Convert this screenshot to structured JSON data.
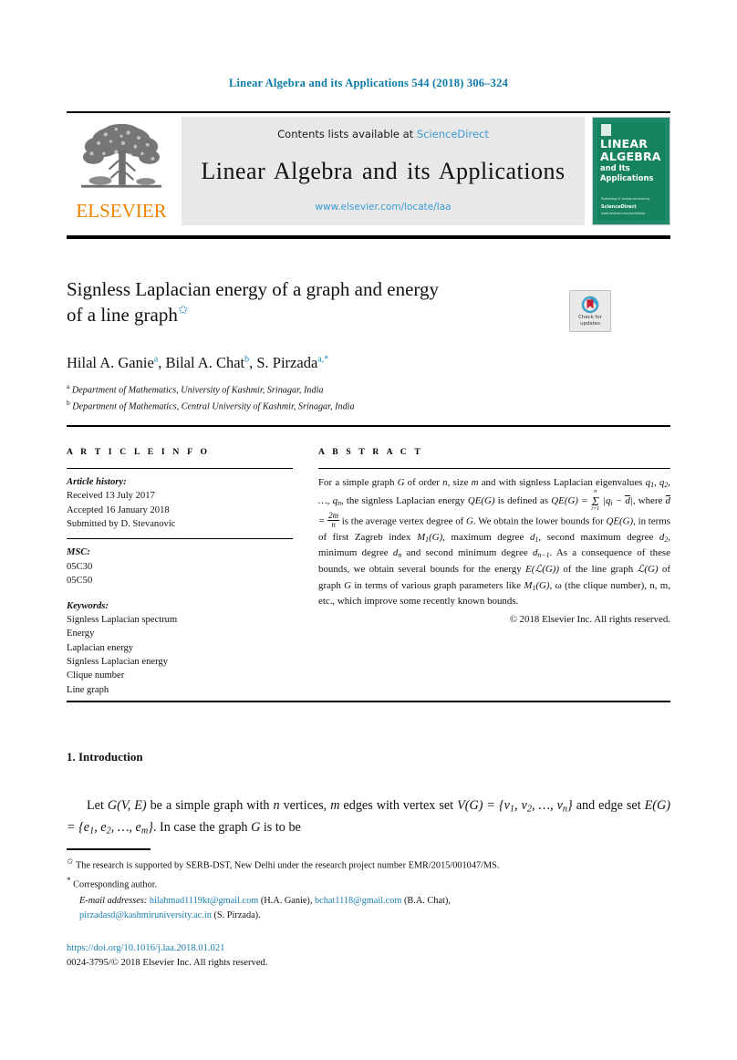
{
  "running_head": "Linear Algebra and its Applications 544 (2018) 306–324",
  "masthead": {
    "publisher_wordmark": "ELSEVIER",
    "contents_prefix": "Contents lists available at ",
    "contents_link": "ScienceDirect",
    "journal_name": "Linear Algebra and its Applications",
    "journal_url": "www.elsevier.com/locate/laa",
    "cover": {
      "line1": "LINEAR",
      "line2": "ALGEBRA",
      "line3": "and Its",
      "line4": "Applications",
      "foot_top": "Publishing & review services by",
      "foot_brand": "ScienceDirect",
      "foot_bottom": "www.elsevier.com/locate/laa",
      "bg_color": "#17825f"
    }
  },
  "title": {
    "line1": "Signless Laplacian energy of a graph and energy",
    "line2": "of a line graph",
    "footnote_mark": "✩"
  },
  "crossmark": {
    "line1": "Check for",
    "line2": "updates"
  },
  "authors": {
    "text": "Hilal A. Ganie",
    "list": [
      {
        "name": "Hilal A. Ganie",
        "mark": "a"
      },
      {
        "name": "Bilal A. Chat",
        "mark": "b"
      },
      {
        "name": "S. Pirzada",
        "mark": "a,*"
      }
    ],
    "affiliations": [
      {
        "mark": "a",
        "text": "Department of Mathematics, University of Kashmir, Srinagar, India"
      },
      {
        "mark": "b",
        "text": "Department of Mathematics, Central University of Kashmir, Srinagar, India"
      }
    ]
  },
  "headings": {
    "article_info": "A R T I C L E   I N F O",
    "abstract": "A B S T R A C T"
  },
  "article_info": {
    "history_label": "Article history:",
    "history": [
      "Received 13 July 2017",
      "Accepted 16 January 2018",
      "Submitted by D. Stevanovic"
    ],
    "msc_label": "MSC:",
    "msc": [
      "05C30",
      "05C50"
    ],
    "keywords_label": "Keywords:",
    "keywords": [
      "Signless Laplacian spectrum",
      "Energy",
      "Laplacian energy",
      "Signless Laplacian energy",
      "Clique number",
      "Line graph"
    ]
  },
  "abstract": {
    "part1": "For a simple graph ",
    "g1": "G",
    "part2": " of order ",
    "n1": "n",
    "part3": ", size ",
    "m1": "m",
    "part4": " and with signless Laplacian eigenvalues ",
    "eig": "q₁, q₂, …, qₙ",
    "part5": ", the signless Laplacian energy ",
    "qe1": "QE(G)",
    "part6": " is defined as ",
    "formula": "QE(G) = Σⁿ_{i=1} |qᵢ − d̄|",
    "part7": ", where ",
    "dbar_def": "d̄ = 2m/n",
    "part8": " is the average vertex degree of ",
    "g2": "G",
    "part9": ". We obtain the lower bounds for ",
    "qe2": "QE(G)",
    "part10": ", in terms of first Zagreb index ",
    "m1g": "M₁(G)",
    "part11": ", maximum degree ",
    "d1": "d₁",
    "part12": ", second maximum degree ",
    "d2": "d₂",
    "part13": ", minimum degree ",
    "dn": "dₙ",
    "part14": " and second minimum degree ",
    "dn1": "dₙ₋₁",
    "part15": ". As a consequence of these bounds, we obtain several bounds for the energy ",
    "elg": "E(ℒ(G))",
    "part16": " of the line graph ",
    "lg": "ℒ(G)",
    "part17": " of graph ",
    "g3": "G",
    "part18": " in terms of various graph parameters like ",
    "m1g2": "M₁(G)",
    "part19": ", ω (the clique number), n, m, etc., which improve some recently known bounds.",
    "copyright": "© 2018 Elsevier Inc. All rights reserved."
  },
  "introduction": {
    "heading": "1. Introduction",
    "paragraph_a": "Let ",
    "paragraph_b": " be a simple graph with ",
    "paragraph_c": " vertices, ",
    "paragraph_d": " edges with vertex set ",
    "paragraph_e": " and edge set ",
    "paragraph_f": ". In case the graph ",
    "paragraph_g": " is to be"
  },
  "footnotes": {
    "funding_mark": "✩",
    "funding_text": "The research is supported by SERB-DST, New Delhi under the research project number EMR/2015/001047/MS.",
    "corresponding_mark": "*",
    "corresponding_text": "Corresponding author.",
    "emails_label": "E-mail addresses:",
    "emails": [
      {
        "address": "hilahmad1119kt@gmail.com",
        "owner": "(H.A. Ganie)"
      },
      {
        "address": "bchat1118@gmail.com",
        "owner": "(B.A. Chat)"
      },
      {
        "address": "pirzadasd@kashmiruniversity.ac.in",
        "owner": "(S. Pirzada)."
      }
    ]
  },
  "doi_block": {
    "doi": "https://doi.org/10.1016/j.laa.2018.01.021",
    "issn_line": "0024-3795/© 2018 Elsevier Inc. All rights reserved."
  },
  "colors": {
    "link_blue": "#1a7fb3",
    "sciencedirect_blue": "#3d9bd4",
    "elsevier_orange": "#ef8200",
    "cover_green": "#17825f"
  }
}
